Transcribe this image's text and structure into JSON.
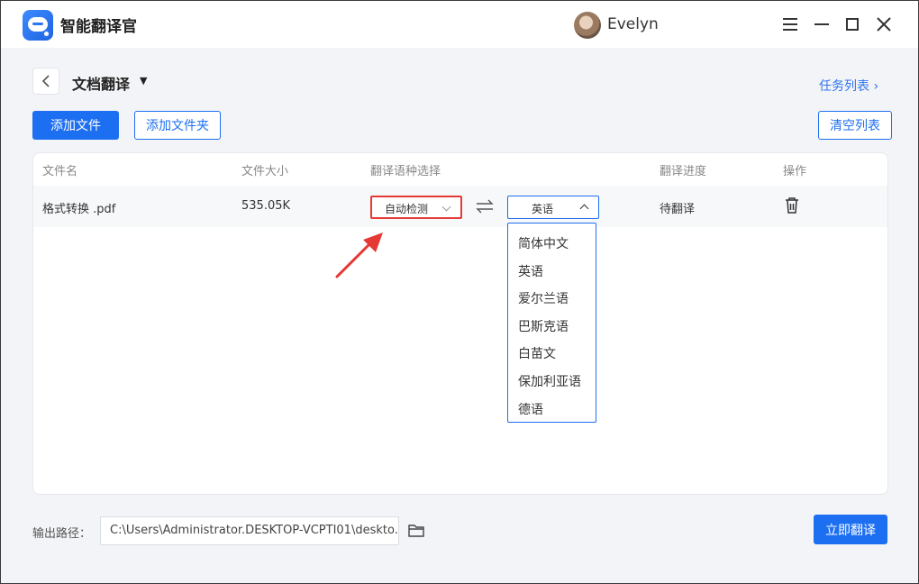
{
  "app": {
    "title": "智能翻译官",
    "accent": "#1d6ff2",
    "highlight": "#e53935"
  },
  "user": {
    "name": "Evelyn"
  },
  "header": {
    "page_title": "文档翻译",
    "task_list_label": "任务列表 ›"
  },
  "toolbar": {
    "add_file": "添加文件",
    "add_folder": "添加文件夹",
    "clear_list": "清空列表"
  },
  "table": {
    "columns": [
      "文件名",
      "文件大小",
      "翻译语种选择",
      "翻译进度",
      "操作"
    ],
    "rows": [
      {
        "filename": "格式转换 .pdf",
        "size": "535.05K",
        "source_lang": "自动检测",
        "target_lang": "英语",
        "status": "待翻译"
      }
    ]
  },
  "target_dropdown": {
    "options": [
      "简体中文",
      "英语",
      "爱尔兰语",
      "巴斯克语",
      "白苗文",
      "保加利亚语",
      "德语"
    ],
    "selected": "英语"
  },
  "footer": {
    "output_label": "输出路径：",
    "output_path": "C:\\Users\\Administrator.DESKTOP-VCPTI01\\deskto...",
    "translate_now": "立即翻译"
  },
  "icons": [
    "app-logo-icon",
    "avatar",
    "menu-icon",
    "minimize-icon",
    "maximize-icon",
    "close-icon",
    "back-icon",
    "caret-down-icon",
    "swap-icon",
    "chevron-down-icon",
    "chevron-up-icon",
    "trash-icon",
    "folder-icon",
    "arrow-annotation"
  ]
}
